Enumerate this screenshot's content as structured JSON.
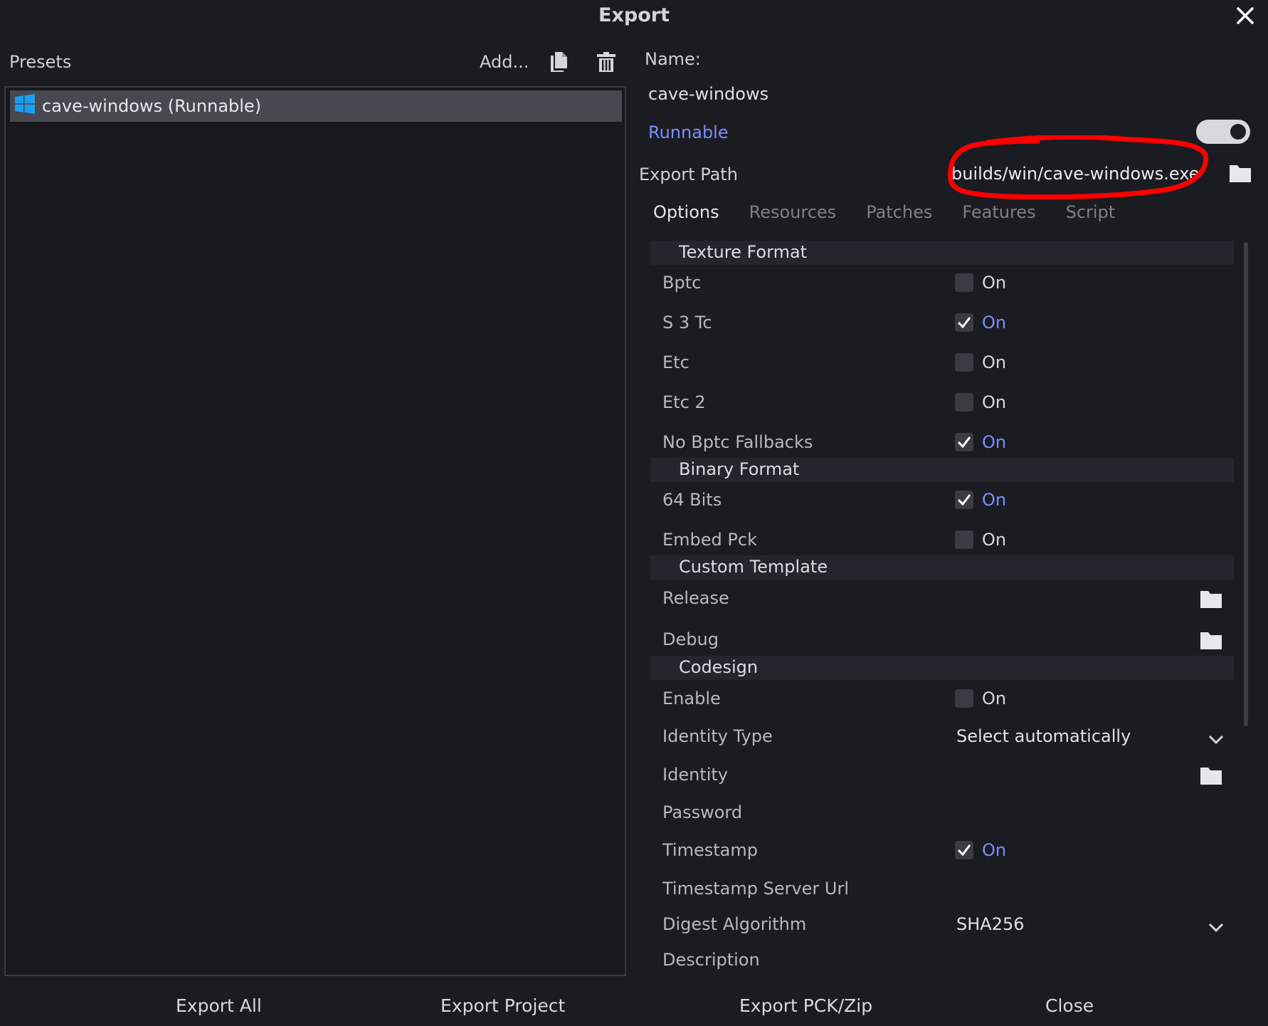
{
  "window": {
    "title": "Export",
    "close_icon": "close-icon"
  },
  "presets": {
    "label": "Presets",
    "add_label": "Add...",
    "items": [
      {
        "label": "cave-windows (Runnable)",
        "icon": "windows-logo-icon"
      }
    ]
  },
  "details": {
    "name_label": "Name:",
    "name_value": "cave-windows",
    "runnable_label": "Runnable",
    "runnable_enabled": true,
    "export_path_label": "Export Path",
    "export_path_value": "builds/win/cave-windows.exe"
  },
  "tabs": [
    {
      "label": "Options",
      "active": true
    },
    {
      "label": "Resources",
      "active": false
    },
    {
      "label": "Patches",
      "active": false
    },
    {
      "label": "Features",
      "active": false
    },
    {
      "label": "Script",
      "active": false
    }
  ],
  "options": {
    "on_text": "On",
    "sections": {
      "texture_format": "Texture Format",
      "binary_format": "Binary Format",
      "custom_template": "Custom Template",
      "codesign": "Codesign"
    },
    "rows": {
      "bptc": {
        "label": "Bptc",
        "checked": false
      },
      "s3tc": {
        "label": "S 3 Tc",
        "checked": true
      },
      "etc": {
        "label": "Etc",
        "checked": false
      },
      "etc2": {
        "label": "Etc 2",
        "checked": false
      },
      "no_bptc_fallbacks": {
        "label": "No Bptc Fallbacks",
        "checked": true
      },
      "bits64": {
        "label": "64 Bits",
        "checked": true
      },
      "embed_pck": {
        "label": "Embed Pck",
        "checked": false
      },
      "release": {
        "label": "Release"
      },
      "debug": {
        "label": "Debug"
      },
      "enable": {
        "label": "Enable",
        "checked": false
      },
      "identity_type": {
        "label": "Identity Type",
        "value": "Select automatically"
      },
      "identity": {
        "label": "Identity"
      },
      "password": {
        "label": "Password"
      },
      "timestamp": {
        "label": "Timestamp",
        "checked": true
      },
      "timestamp_server_url": {
        "label": "Timestamp Server Url"
      },
      "digest_algorithm": {
        "label": "Digest Algorithm",
        "value": "SHA256"
      },
      "description": {
        "label": "Description"
      }
    }
  },
  "footer": {
    "export_all": "Export All",
    "export_project": "Export Project",
    "export_pck_zip": "Export PCK/Zip",
    "close": "Close"
  },
  "colors": {
    "accent": "#7b8dff",
    "background": "#1b1c22",
    "annotation_red": "#ff0000"
  }
}
